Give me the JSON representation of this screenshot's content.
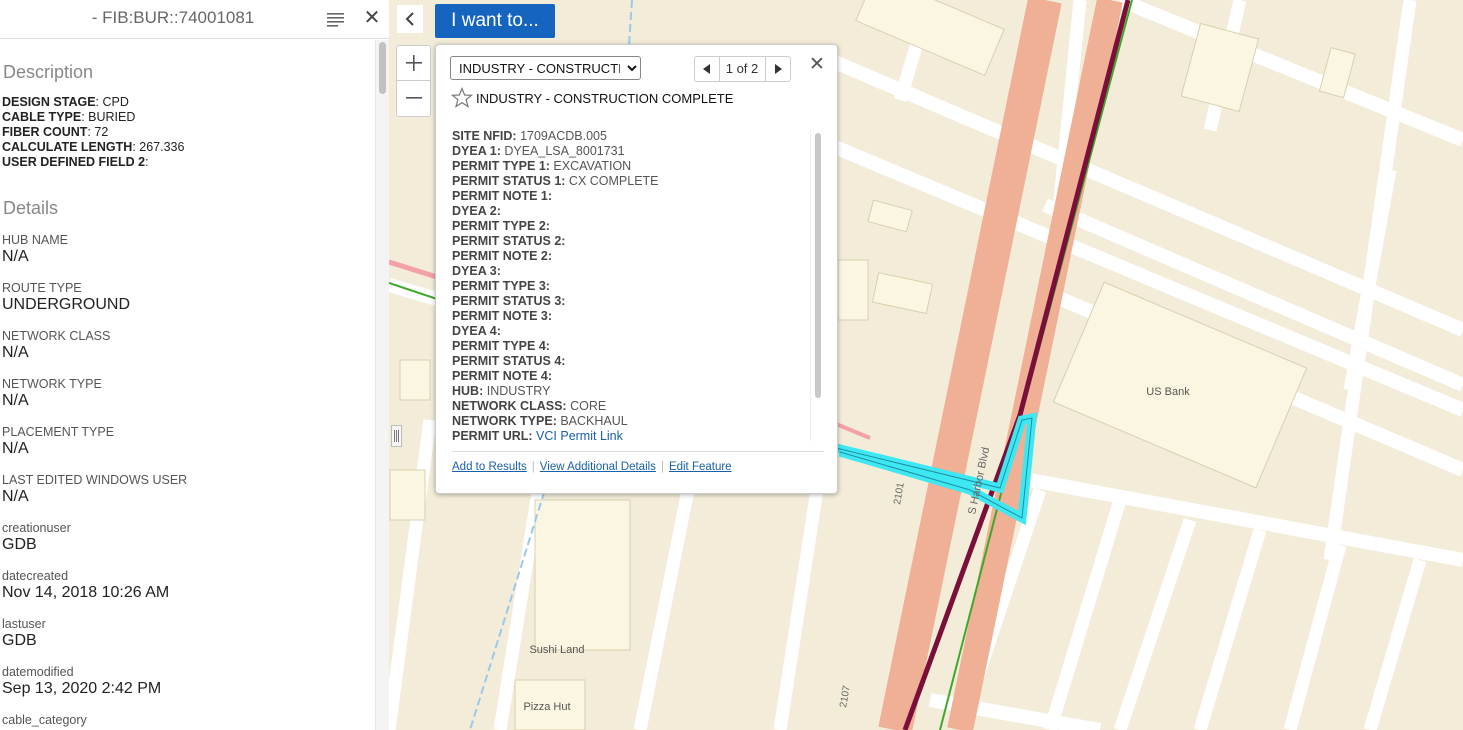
{
  "panel": {
    "title": "- FIB:BUR::74001081",
    "description_heading": "Description",
    "description": [
      {
        "label": "DESIGN STAGE",
        "value": "CPD"
      },
      {
        "label": "CABLE TYPE",
        "value": "BURIED"
      },
      {
        "label": "FIBER COUNT",
        "value": "72"
      },
      {
        "label": "CALCULATE LENGTH",
        "value": "267.336"
      },
      {
        "label": "USER DEFINED FIELD 2",
        "value": ""
      }
    ],
    "details_heading": "Details",
    "details": [
      {
        "label": "HUB NAME",
        "value": "N/A"
      },
      {
        "label": "ROUTE TYPE",
        "value": "UNDERGROUND"
      },
      {
        "label": "NETWORK CLASS",
        "value": "N/A"
      },
      {
        "label": "NETWORK TYPE",
        "value": "N/A"
      },
      {
        "label": "PLACEMENT TYPE",
        "value": "N/A"
      },
      {
        "label": "LAST EDITED WINDOWS USER",
        "value": "N/A"
      },
      {
        "label": "creationuser",
        "value": "GDB"
      },
      {
        "label": "datecreated",
        "value": "Nov 14, 2018 10:26 AM"
      },
      {
        "label": "lastuser",
        "value": "GDB"
      },
      {
        "label": "datemodified",
        "value": "Sep 13, 2020 2:42 PM"
      },
      {
        "label": "cable_category",
        "value": ""
      }
    ]
  },
  "toolbar": {
    "want_to_label": "I want to..."
  },
  "popup": {
    "layer_selected": "INDUSTRY - CONSTRUCTION COMPLETE",
    "pager_text": "1 of 2",
    "title": "INDUSTRY - CONSTRUCTION COMPLETE",
    "fields": [
      {
        "label": "SITE NFID:",
        "value": "1709ACDB.005"
      },
      {
        "label": "DYEA 1:",
        "value": "DYEA_LSA_8001731"
      },
      {
        "label": "PERMIT TYPE 1:",
        "value": "EXCAVATION"
      },
      {
        "label": "PERMIT STATUS 1:",
        "value": "CX COMPLETE"
      },
      {
        "label": "PERMIT NOTE 1:",
        "value": ""
      },
      {
        "label": "DYEA 2:",
        "value": ""
      },
      {
        "label": "PERMIT TYPE 2:",
        "value": ""
      },
      {
        "label": "PERMIT STATUS 2:",
        "value": ""
      },
      {
        "label": "PERMIT NOTE 2:",
        "value": ""
      },
      {
        "label": "DYEA 3:",
        "value": ""
      },
      {
        "label": "PERMIT TYPE 3:",
        "value": ""
      },
      {
        "label": "PERMIT STATUS 3:",
        "value": ""
      },
      {
        "label": "PERMIT NOTE 3:",
        "value": ""
      },
      {
        "label": "DYEA 4:",
        "value": ""
      },
      {
        "label": "PERMIT TYPE 4:",
        "value": ""
      },
      {
        "label": "PERMIT STATUS 4:",
        "value": ""
      },
      {
        "label": "PERMIT NOTE 4:",
        "value": ""
      },
      {
        "label": "HUB:",
        "value": "INDUSTRY"
      },
      {
        "label": "NETWORK CLASS:",
        "value": "CORE"
      },
      {
        "label": "NETWORK TYPE:",
        "value": "BACKHAUL"
      }
    ],
    "permit_url_label": "PERMIT URL:",
    "permit_url_text": "VCI Permit Link",
    "actions": {
      "add_to_results": "Add to Results",
      "view_details": "View Additional Details",
      "edit_feature": "Edit Feature"
    }
  },
  "map": {
    "labels": {
      "bank": "US Bank",
      "sushi": "Sushi Land",
      "pizza": "Pizza Hut",
      "street": "S Harbor Blvd",
      "num_2101": "2101",
      "num_2107": "2107"
    },
    "colors": {
      "land": "#f2ecd8",
      "block": "#faf6e2",
      "road": "#ffffff",
      "highway": "#f0b096",
      "fiber_line": "#7a0f3a",
      "green_line": "#3fa82b",
      "highlight": "#3ee8f2"
    }
  }
}
